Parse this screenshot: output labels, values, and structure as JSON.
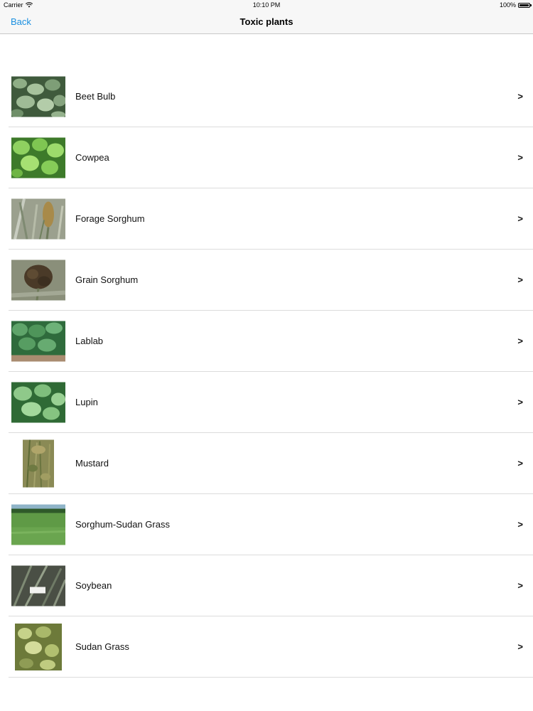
{
  "status_bar": {
    "carrier": "Carrier",
    "time": "10:10 PM",
    "battery": "100%"
  },
  "nav": {
    "back_label": "Back",
    "title": "Toxic plants"
  },
  "chevron_glyph": ">",
  "plants": [
    {
      "name": "Beet Bulb"
    },
    {
      "name": "Cowpea"
    },
    {
      "name": "Forage Sorghum"
    },
    {
      "name": "Grain Sorghum"
    },
    {
      "name": "Lablab"
    },
    {
      "name": "Lupin"
    },
    {
      "name": "Mustard"
    },
    {
      "name": "Sorghum-Sudan Grass"
    },
    {
      "name": "Soybean"
    },
    {
      "name": "Sudan Grass"
    }
  ]
}
